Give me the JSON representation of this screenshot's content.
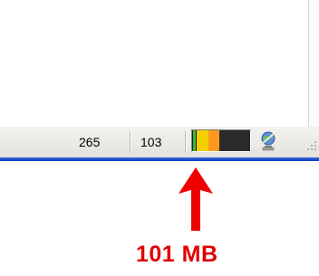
{
  "statusbar": {
    "field_1": "265",
    "field_2": "103",
    "memory_meter": {
      "colors": [
        "#3db83d",
        "#f4d000",
        "#ff9a1c",
        "#2a2a2a"
      ]
    },
    "network_icon": "network-globe-icon",
    "resize_grip_icon": "resize-grip-icon"
  },
  "annotation": {
    "arrow_icon": "up-arrow-icon",
    "arrow_color": "#ee0000",
    "label": "101 MB",
    "label_color": "#e00000"
  },
  "accent": {
    "taskbar_blue": "#0a3cc0"
  }
}
